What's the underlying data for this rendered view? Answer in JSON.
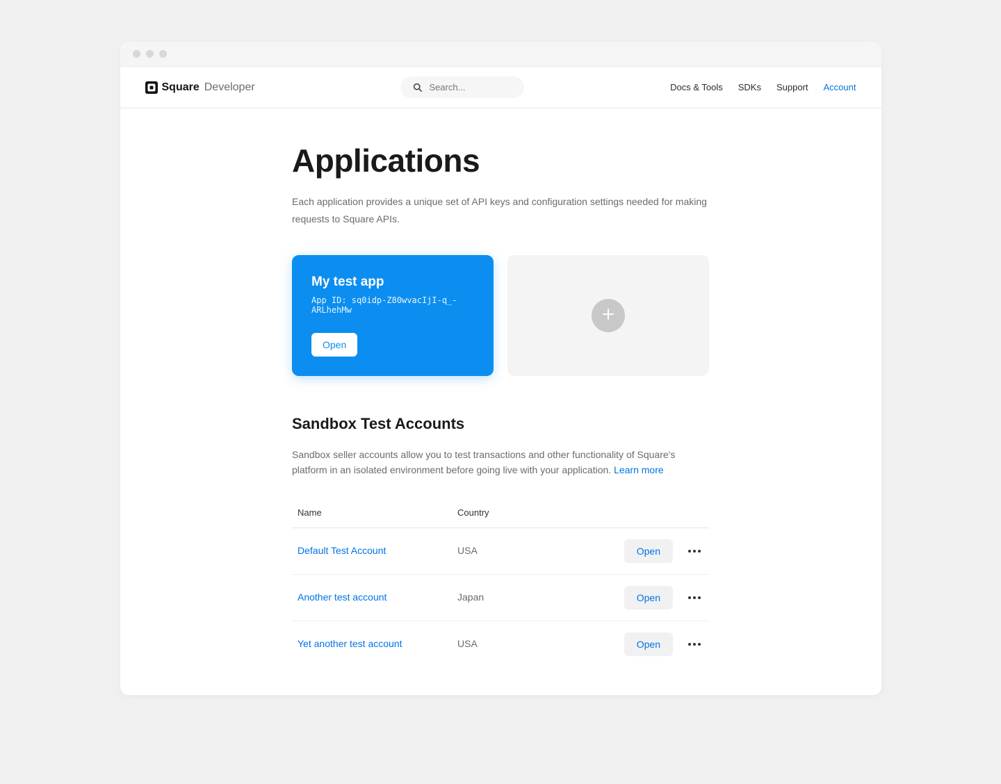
{
  "brand": {
    "name": "Square",
    "sub": "Developer"
  },
  "search": {
    "placeholder": "Search..."
  },
  "nav": {
    "docs": "Docs & Tools",
    "sdks": "SDKs",
    "support": "Support",
    "account": "Account"
  },
  "page": {
    "title": "Applications",
    "description": "Each application provides a unique set of API keys and configuration settings needed for making requests to Square APIs."
  },
  "app_card": {
    "name": "My test app",
    "id_label": "App ID: sq0idp-Z80wvacIjI-q_-ARLhehMw",
    "open": "Open"
  },
  "sandbox": {
    "title": "Sandbox Test Accounts",
    "description": "Sandbox seller accounts allow you to test transactions and other functionality of Square's platform in an isolated environment before going live with your application. ",
    "learn_more": "Learn more",
    "columns": {
      "name": "Name",
      "country": "Country"
    },
    "open_label": "Open",
    "accounts": [
      {
        "name": "Default Test Account",
        "country": "USA"
      },
      {
        "name": "Another test account",
        "country": "Japan"
      },
      {
        "name": "Yet another test account",
        "country": "USA"
      }
    ]
  }
}
